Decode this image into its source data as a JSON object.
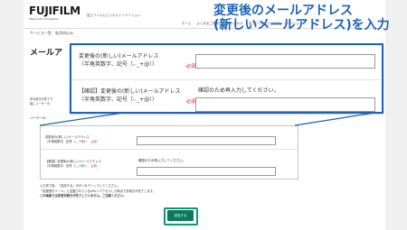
{
  "header": {
    "logo": "FUJIFILM",
    "logo_tagline": "Value from Innovation",
    "site_title": "富士フイルムビジネスイノベーション",
    "nav": [
      "ホーム",
      "よくあるご質問",
      "お問い合わせ",
      "富士フイルムビジネスイノベーション"
    ]
  },
  "breadcrumb": "サービス一覧　転用申込み",
  "page_title": "メールア",
  "intro": "本手続きが完了す\n後にユーザーの",
  "user_id_label": "ユーザーID",
  "form": {
    "new_email_label": "変更後の(新しい)メールアドレス",
    "new_email_hint": "（半角英数字、記号（-._+@））",
    "confirm_label": "【確認】変更後の(新しい)メールアドレス",
    "confirm_hint": "（半角英数字、記号（-._+@））",
    "required": "必須",
    "confirm_prompt": "確認のため再入力してください。"
  },
  "notes": [
    "入力完了後、「送信する」ボタンをクリックしてください。",
    "「変更受付メール」に記載されているURLへアクセスした時点で手続きが完了します。",
    "この画面では変更手続きが完了していません。ご注意ください。"
  ],
  "submit_label": "送信する",
  "callout": {
    "line1": "変更後のメールアドレス",
    "line2": "(新しいメールアドレス)を入力"
  },
  "colors": {
    "accent": "#1e63b6",
    "required": "#e60012",
    "submit": "#0a7a5a"
  }
}
